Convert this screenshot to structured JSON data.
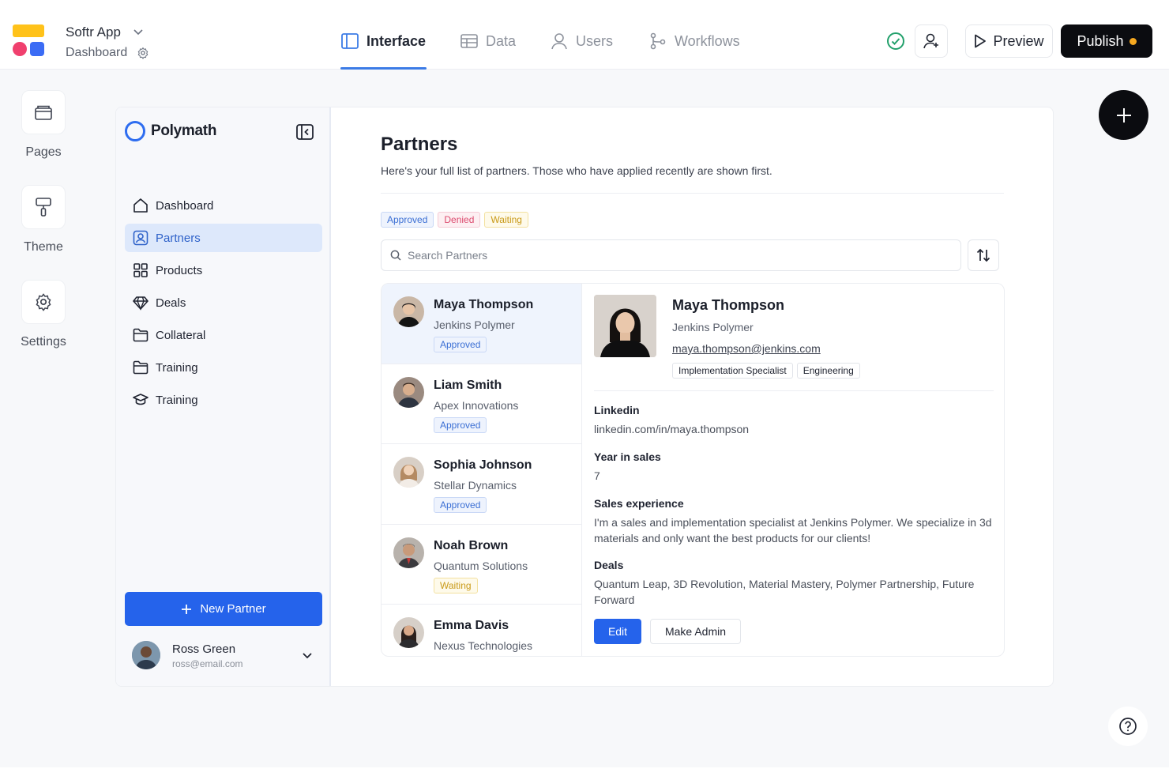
{
  "app": {
    "name": "Softr App",
    "page": "Dashboard"
  },
  "tabs": [
    {
      "label": "Interface",
      "icon": "layout-panel-icon",
      "active": true
    },
    {
      "label": "Data",
      "icon": "table-icon",
      "active": false
    },
    {
      "label": "Users",
      "icon": "user-icon",
      "active": false
    },
    {
      "label": "Workflows",
      "icon": "workflow-icon",
      "active": false
    }
  ],
  "toolbar": {
    "preview_label": "Preview",
    "publish_label": "Publish"
  },
  "left_rail": [
    {
      "label": "Pages",
      "icon": "pages-icon"
    },
    {
      "label": "Theme",
      "icon": "paint-roller-icon"
    },
    {
      "label": "Settings",
      "icon": "gear-icon"
    }
  ],
  "sidebar": {
    "brand": "Polymath",
    "items": [
      {
        "label": "Dashboard",
        "icon": "home-icon",
        "active": false
      },
      {
        "label": "Partners",
        "icon": "contact-icon",
        "active": true
      },
      {
        "label": "Products",
        "icon": "grid-icon",
        "active": false
      },
      {
        "label": "Deals",
        "icon": "diamond-icon",
        "active": false
      },
      {
        "label": "Collateral",
        "icon": "folder-icon",
        "active": false
      },
      {
        "label": "Training",
        "icon": "folder-icon",
        "active": false
      },
      {
        "label": "Training",
        "icon": "graduation-cap-icon",
        "active": false
      }
    ],
    "new_button": "New Partner",
    "user": {
      "name": "Ross Green",
      "email": "ross@email.com"
    }
  },
  "main": {
    "title": "Partners",
    "subtitle": "Here's your full list of partners. Those who have applied recently are shown first.",
    "filters": [
      "Approved",
      "Denied",
      "Waiting"
    ],
    "search_placeholder": "Search Partners"
  },
  "partners": [
    {
      "name": "Maya Thompson",
      "company": "Jenkins Polymer",
      "status": "Approved",
      "active": true
    },
    {
      "name": "Liam Smith",
      "company": "Apex Innovations",
      "status": "Approved",
      "active": false
    },
    {
      "name": "Sophia Johnson",
      "company": "Stellar Dynamics",
      "status": "Approved",
      "active": false
    },
    {
      "name": "Noah Brown",
      "company": "Quantum Solutions",
      "status": "Waiting",
      "active": false
    },
    {
      "name": "Emma Davis",
      "company": "Nexus Technologies",
      "status": "",
      "active": false
    }
  ],
  "detail": {
    "name": "Maya Thompson",
    "company": "Jenkins Polymer",
    "email": "maya.thompson@jenkins.com",
    "tags": [
      "Implementation Specialist",
      "Engineering"
    ],
    "fields": [
      {
        "label": "Linkedin",
        "value": "linkedin.com/in/maya.thompson"
      },
      {
        "label": "Year in sales",
        "value": "7"
      },
      {
        "label": "Sales experience",
        "value": "I'm a sales and implementation specialist at Jenkins Polymer. We specialize in 3d materials and only want the best products for our clients!"
      },
      {
        "label": "Deals",
        "value": "Quantum Leap, 3D Revolution, Material Mastery, Polymer Partnership, Future Forward"
      }
    ],
    "edit_label": "Edit",
    "admin_label": "Make Admin"
  },
  "colors": {
    "accent": "#2563eb",
    "publish_dot": "#f7a920",
    "status_ok": "#22a06b"
  }
}
